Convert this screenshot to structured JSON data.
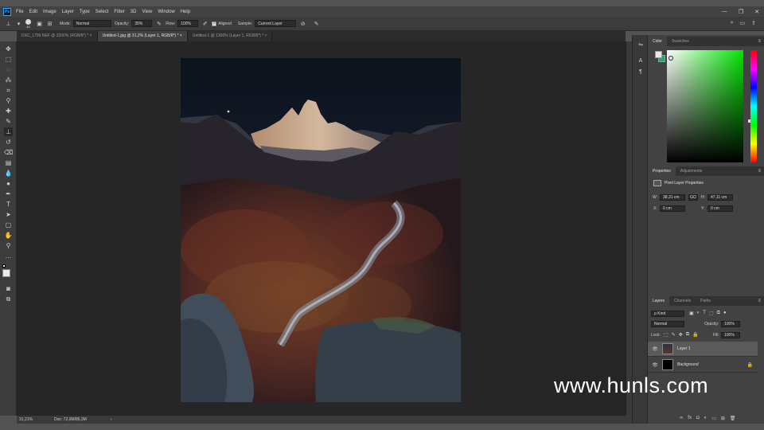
{
  "menu": {
    "app_logo": "Ps",
    "items": [
      "File",
      "Edit",
      "Image",
      "Layer",
      "Type",
      "Select",
      "Filter",
      "3D",
      "View",
      "Window",
      "Help"
    ],
    "window_controls": {
      "minimize": "—",
      "restore": "❐",
      "close": "✕"
    }
  },
  "options": {
    "brush_size": "40",
    "mode_label": "Mode:",
    "mode_value": "Normal",
    "opacity_label": "Opacity:",
    "opacity_value": "35%",
    "flow_label": "Flow:",
    "flow_value": "100%",
    "aligned_label": "Aligned",
    "sample_label": "Sample:",
    "sample_value": "Current Layer"
  },
  "tabs": [
    {
      "label": "DSC_1799.NEF @ 3200% (RGB/8*) *  ×"
    },
    {
      "label": "Untitled-1.jpg @ 31,2% (Layer 1, RGB/8*) *  ×"
    },
    {
      "label": "Untitled-1 @ 1300% (Layer 1, RGB/8*) *  ×"
    }
  ],
  "status": {
    "zoom": "31,21%",
    "doc": "Doc: 72,0M/86,3M",
    "arrow": "›"
  },
  "color_panel": {
    "tabs": [
      "Color",
      "Swatches"
    ],
    "fg_color": "#e8e8e8",
    "bg_color": "#2fa36f",
    "hue_color": "#00e600"
  },
  "properties_panel": {
    "tabs": [
      "Properties",
      "Adjustments"
    ],
    "title": "Pixel Layer Properties",
    "w_label": "W:",
    "w_value": "38,31 cm",
    "link_label": "GO",
    "h_label": "H:",
    "h_value": "47,11 cm",
    "x_label": "X:",
    "x_value": "0 cm",
    "y_label": "Y:",
    "y_value": "0 cm"
  },
  "layers_panel": {
    "tabs": [
      "Layers",
      "Channels",
      "Paths"
    ],
    "kind_value": "ρ Kind",
    "blend_value": "Normal",
    "opacity_label": "Opacity:",
    "opacity_value": "100%",
    "lock_label": "Lock:",
    "fill_label": "Fill:",
    "fill_value": "100%",
    "layers": [
      {
        "name": "Layer 1",
        "selected": true
      },
      {
        "name": "Background",
        "selected": false
      }
    ],
    "footer_icons": [
      "link-icon",
      "fx-icon",
      "mask-icon",
      "adjustment-icon",
      "folder-icon",
      "new-layer-icon",
      "trash-icon"
    ]
  },
  "watermark": "www.hunls.com"
}
